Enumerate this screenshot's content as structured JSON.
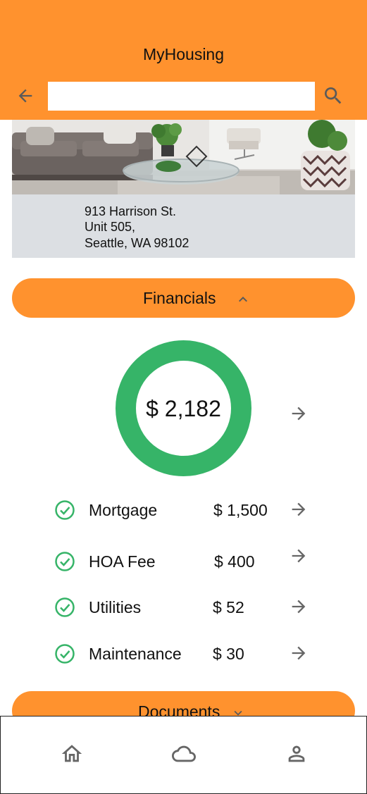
{
  "app": {
    "title": "MyHousing"
  },
  "search": {
    "value": "",
    "placeholder": ""
  },
  "property": {
    "address_line1": "913 Harrison St.",
    "address_line2": "Unit 505,",
    "address_line3": "Seattle, WA 98102"
  },
  "financials": {
    "label": "Financials",
    "expanded": true,
    "total": "$ 2,182",
    "items": [
      {
        "label": "Mortgage",
        "amount": "$ 1,500",
        "status": "paid"
      },
      {
        "label": "HOA Fee",
        "amount": "$ 400",
        "status": "paid"
      },
      {
        "label": "Utilities",
        "amount": "$ 52",
        "status": "paid"
      },
      {
        "label": "Maintenance",
        "amount": "$ 30",
        "status": "paid"
      }
    ]
  },
  "documents": {
    "label": "Documents",
    "expanded": false
  },
  "nav": {
    "items": [
      "home-icon",
      "cloud-icon",
      "profile-icon"
    ]
  },
  "colors": {
    "brand": "#ff922e",
    "success": "#36b468",
    "address_bg": "#dcdfe3",
    "icon_gray": "#666666"
  }
}
